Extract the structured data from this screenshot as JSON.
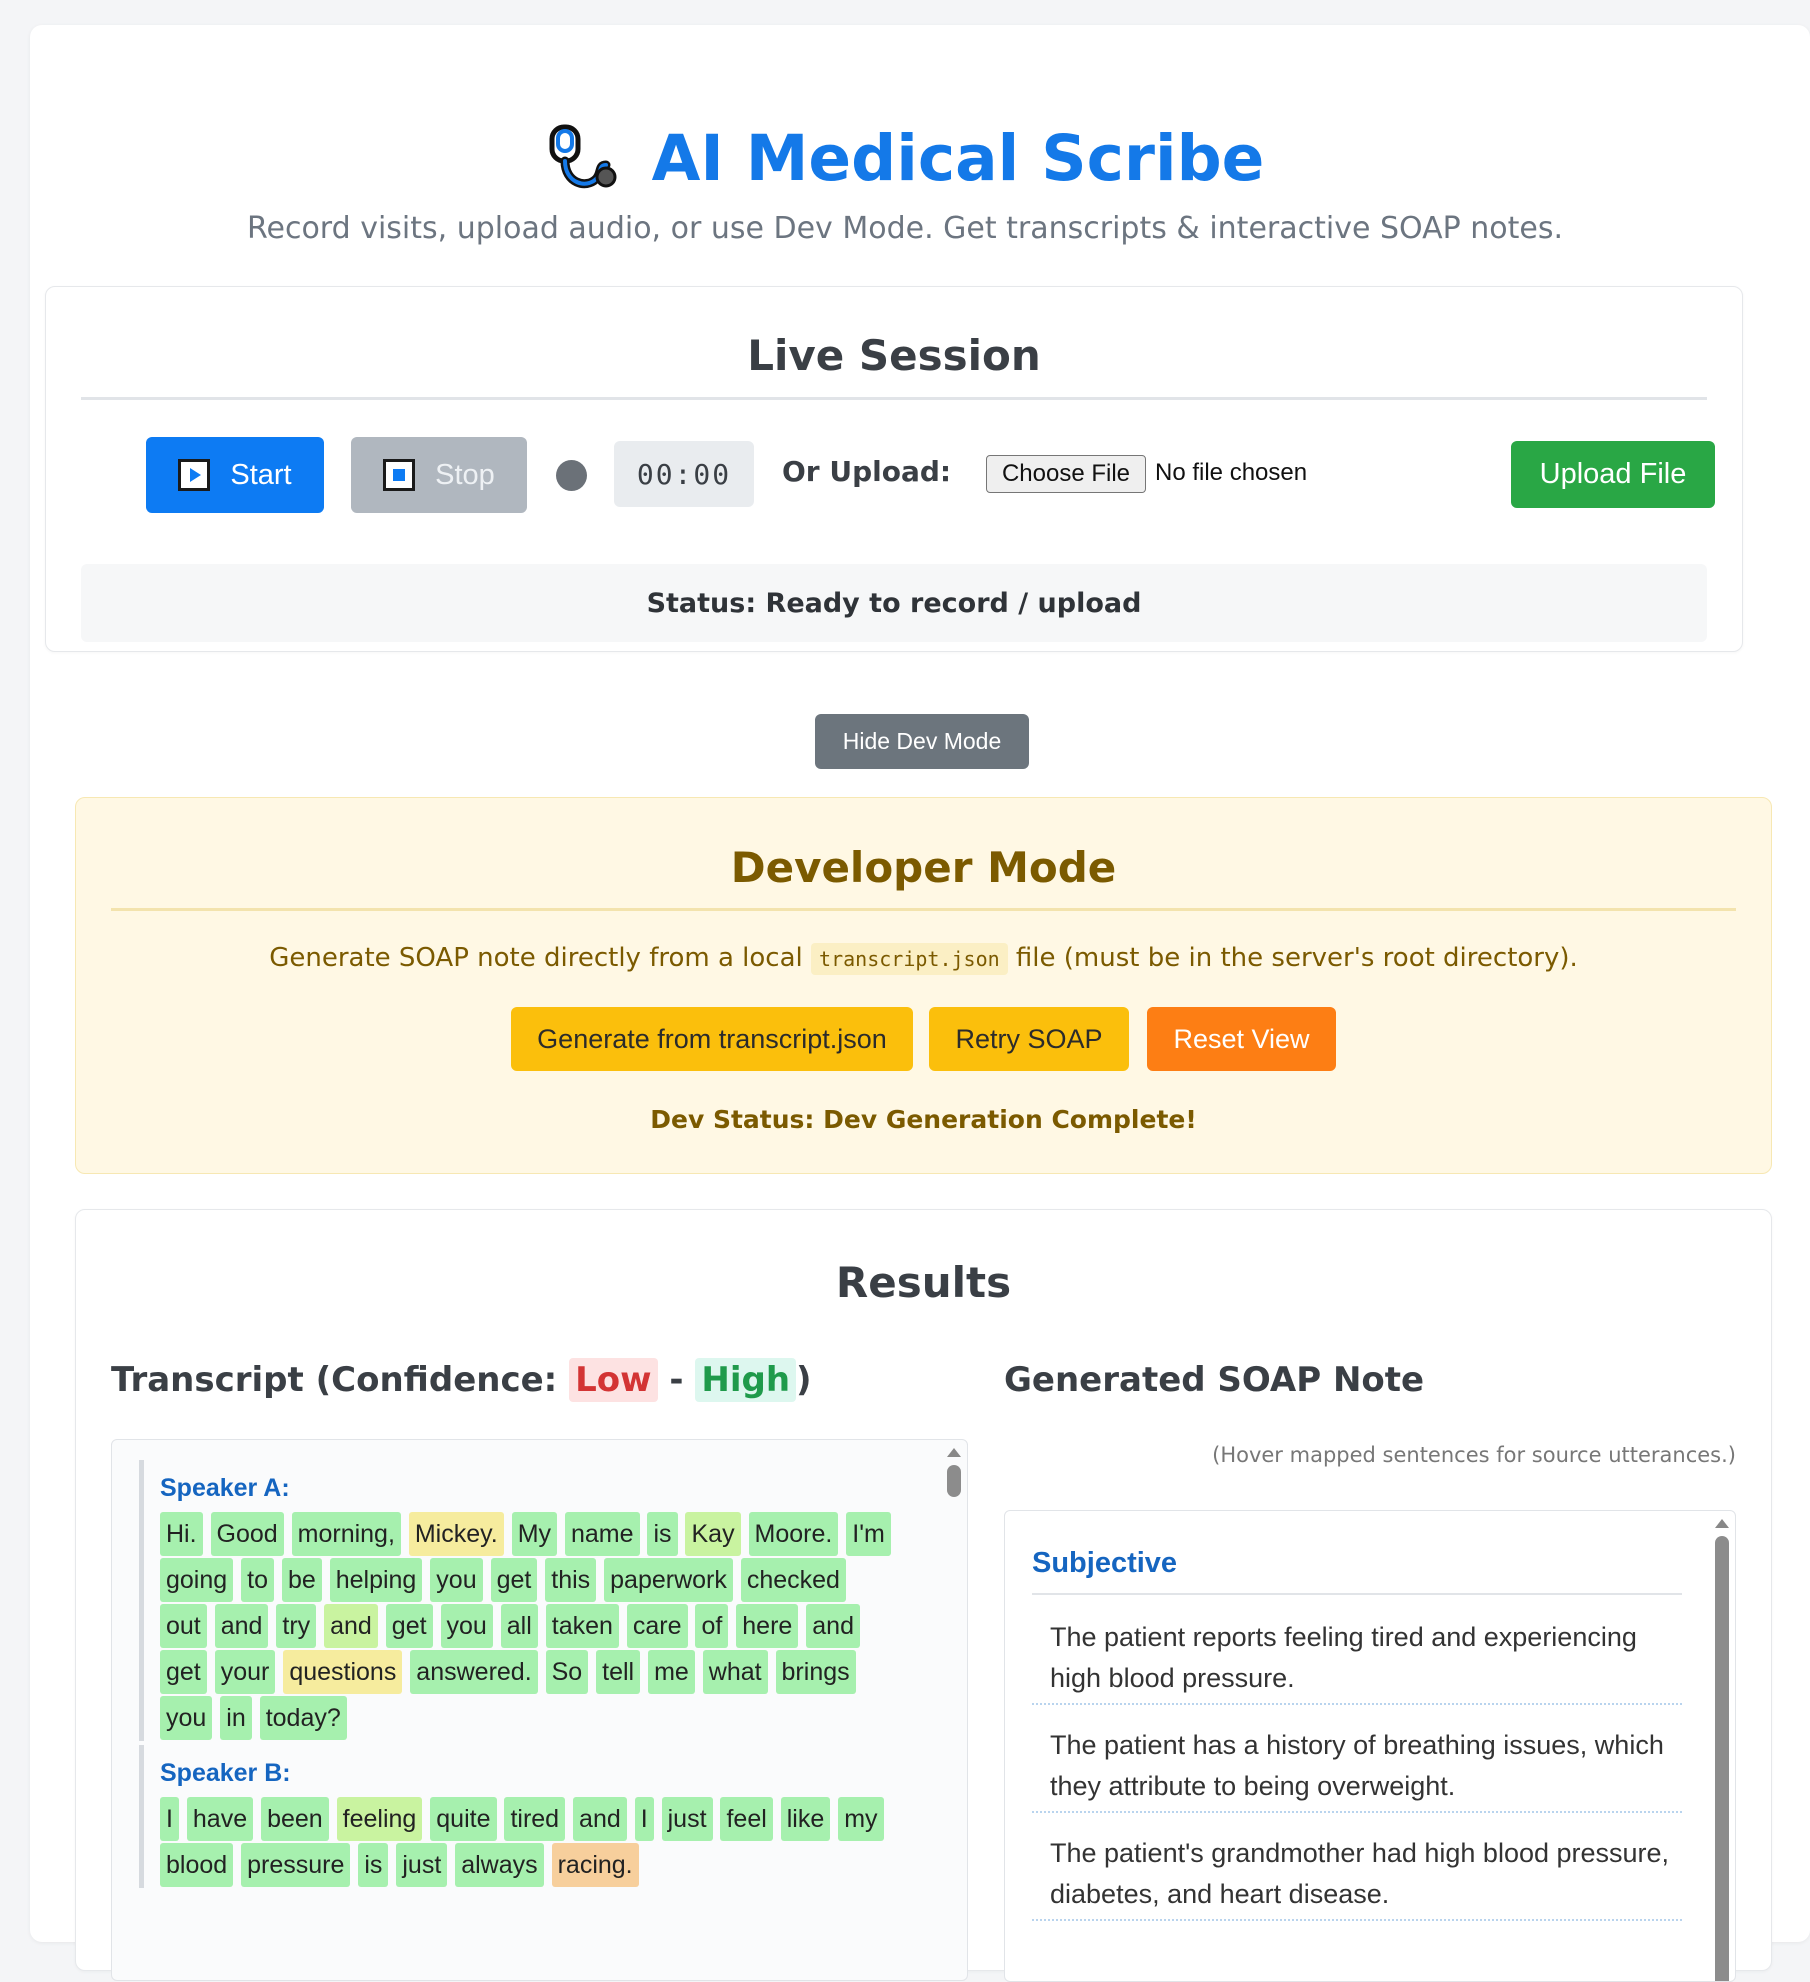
{
  "header": {
    "title": "AI Medical Scribe",
    "subtitle": "Record visits, upload audio, or use Dev Mode. Get transcripts & interactive SOAP notes.",
    "logo_icon": "stethoscope-icon"
  },
  "live_session": {
    "title": "Live Session",
    "start_label": "Start",
    "stop_label": "Stop",
    "timer": "00:00",
    "upload_label": "Or Upload:",
    "choose_file_label": "Choose File",
    "no_file_text": "No file chosen",
    "upload_button": "Upload File",
    "status": "Status: Ready to record / upload"
  },
  "dev_toggle": {
    "label": "Hide Dev Mode"
  },
  "developer_mode": {
    "title": "Developer Mode",
    "desc_before": "Generate SOAP note directly from a local",
    "desc_code": "transcript.json",
    "desc_after": "file (must be in the server's root directory).",
    "generate_label": "Generate from transcript.json",
    "retry_label": "Retry SOAP",
    "reset_label": "Reset View",
    "status": "Dev Status: Dev Generation Complete!"
  },
  "results": {
    "title": "Results",
    "transcript_title_prefix": "Transcript (Confidence:",
    "conf_low": "Low",
    "conf_sep": "-",
    "conf_high": "High",
    "transcript_title_suffix": ")",
    "soap_title": "Generated SOAP Note",
    "hover_note": "(Hover mapped sentences for source utterances.)",
    "utterances": [
      {
        "speaker": "Speaker A:",
        "words": [
          {
            "t": "Hi.",
            "c": "h"
          },
          {
            "t": "Good",
            "c": "h"
          },
          {
            "t": "morning,",
            "c": "h"
          },
          {
            "t": "Mickey.",
            "c": "l"
          },
          {
            "t": "My",
            "c": "h"
          },
          {
            "t": "name",
            "c": "h"
          },
          {
            "t": "is",
            "c": "h"
          },
          {
            "t": "Kay",
            "c": "m"
          },
          {
            "t": "Moore.",
            "c": "h"
          },
          {
            "t": "I'm",
            "c": "h"
          },
          {
            "t": "going",
            "c": "h"
          },
          {
            "t": "to",
            "c": "h"
          },
          {
            "t": "be",
            "c": "h"
          },
          {
            "t": "helping",
            "c": "h"
          },
          {
            "t": "you",
            "c": "h"
          },
          {
            "t": "get",
            "c": "h"
          },
          {
            "t": "this",
            "c": "h"
          },
          {
            "t": "paperwork",
            "c": "h"
          },
          {
            "t": "checked",
            "c": "h"
          },
          {
            "t": "out",
            "c": "h"
          },
          {
            "t": "and",
            "c": "h"
          },
          {
            "t": "try",
            "c": "h"
          },
          {
            "t": "and",
            "c": "m"
          },
          {
            "t": "get",
            "c": "h"
          },
          {
            "t": "you",
            "c": "h"
          },
          {
            "t": "all",
            "c": "h"
          },
          {
            "t": "taken",
            "c": "h"
          },
          {
            "t": "care",
            "c": "h"
          },
          {
            "t": "of",
            "c": "h"
          },
          {
            "t": "here",
            "c": "h"
          },
          {
            "t": "and",
            "c": "h"
          },
          {
            "t": "get",
            "c": "h"
          },
          {
            "t": "your",
            "c": "h"
          },
          {
            "t": "questions",
            "c": "l"
          },
          {
            "t": "answered.",
            "c": "h"
          },
          {
            "t": "So",
            "c": "h"
          },
          {
            "t": "tell",
            "c": "h"
          },
          {
            "t": "me",
            "c": "h"
          },
          {
            "t": "what",
            "c": "h"
          },
          {
            "t": "brings",
            "c": "h"
          },
          {
            "t": "you",
            "c": "h"
          },
          {
            "t": "in",
            "c": "h"
          },
          {
            "t": "today?",
            "c": "h"
          }
        ]
      },
      {
        "speaker": "Speaker B:",
        "words": [
          {
            "t": "I",
            "c": "h"
          },
          {
            "t": "have",
            "c": "h"
          },
          {
            "t": "been",
            "c": "h"
          },
          {
            "t": "feeling",
            "c": "m"
          },
          {
            "t": "quite",
            "c": "h"
          },
          {
            "t": "tired",
            "c": "h"
          },
          {
            "t": "and",
            "c": "h"
          },
          {
            "t": "I",
            "c": "h"
          },
          {
            "t": "just",
            "c": "h"
          },
          {
            "t": "feel",
            "c": "h"
          },
          {
            "t": "like",
            "c": "h"
          },
          {
            "t": "my",
            "c": "h"
          },
          {
            "t": "blood",
            "c": "h"
          },
          {
            "t": "pressure",
            "c": "h"
          },
          {
            "t": "is",
            "c": "h"
          },
          {
            "t": "just",
            "c": "h"
          },
          {
            "t": "always",
            "c": "h"
          },
          {
            "t": "racing.",
            "c": "vl"
          }
        ]
      }
    ],
    "soap": {
      "section": "Subjective",
      "items": [
        "The patient reports feeling tired and experiencing high blood pressure.",
        "The patient has a history of breathing issues, which they attribute to being overweight.",
        "The patient's grandmother had high blood pressure, diabetes, and heart disease."
      ]
    }
  }
}
